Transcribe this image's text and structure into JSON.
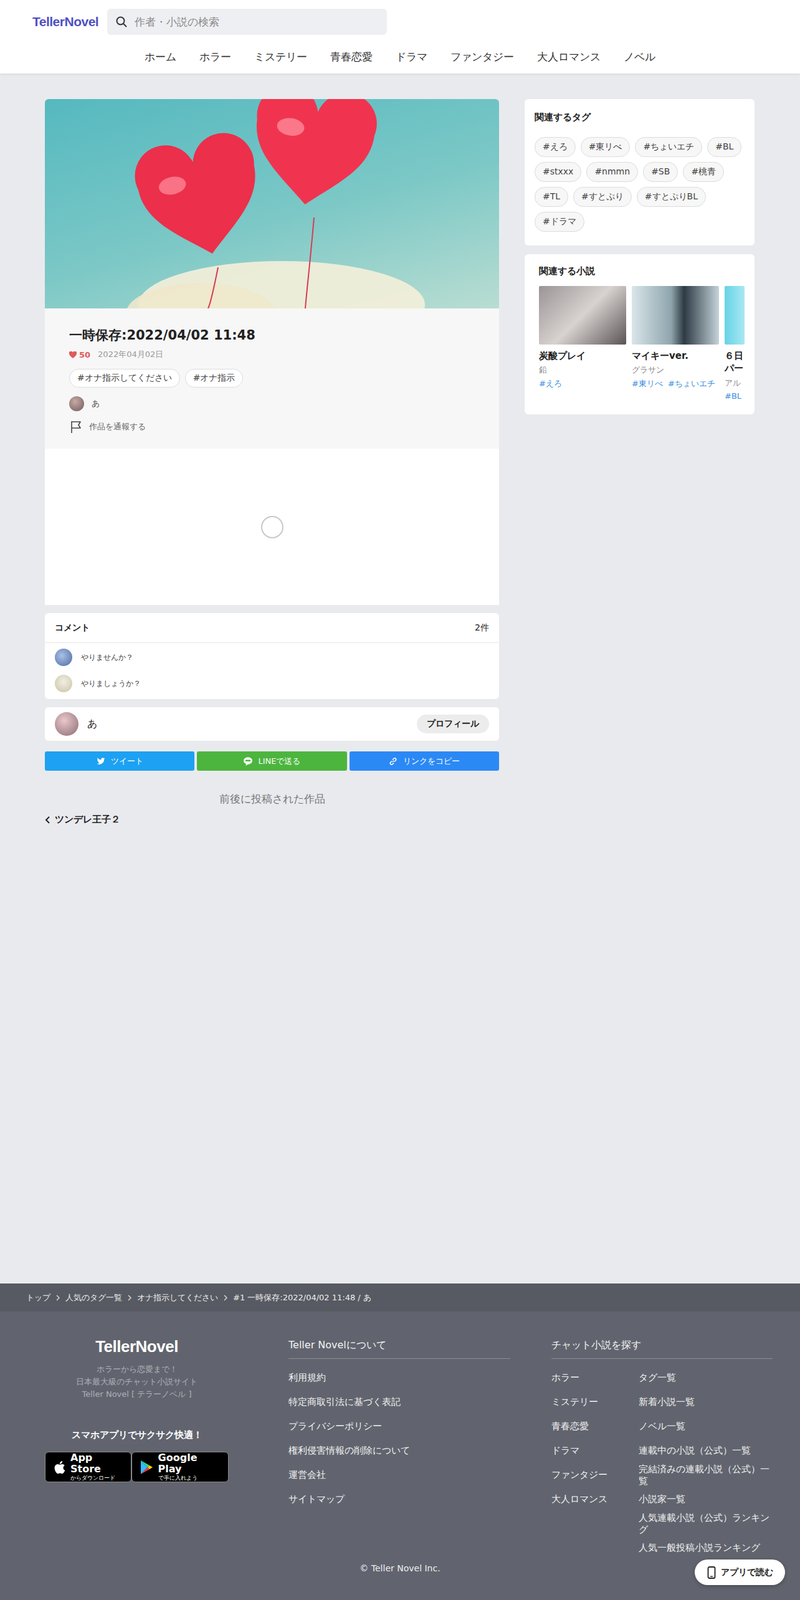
{
  "header": {
    "logo": "TellerNovel",
    "search": {
      "placeholder": "作者・小説の検索"
    },
    "nav": [
      "ホーム",
      "ホラー",
      "ミステリー",
      "青春恋愛",
      "ドラマ",
      "ファンタジー",
      "大人ロマンス",
      "ノベル"
    ]
  },
  "novel": {
    "title": "一時保存:2022/04/02 11:48",
    "likes": "50",
    "date": "2022年04月02日",
    "tags": [
      "#オナ指示してください",
      "#オナ指示"
    ],
    "author": "あ",
    "report": "作品を通報する",
    "loading": true
  },
  "comments": {
    "title": "コメント",
    "count": "2件",
    "items": [
      "やりませんか？",
      "やりましょうか？"
    ]
  },
  "profile": {
    "name": "あ",
    "button": "プロフィール"
  },
  "share": [
    {
      "label": "ツイート",
      "color": "#1da1f2",
      "kind": "twitter"
    },
    {
      "label": "LINEで送る",
      "color": "#4cb53e",
      "kind": "line"
    },
    {
      "label": "リンクをコピー",
      "color": "#2b89f5",
      "kind": "link"
    }
  ],
  "adjacent": {
    "title": "前後に投稿された作品",
    "prev": "ツンデレ王子２"
  },
  "sidebar": {
    "tags_title": "関連するタグ",
    "tags": [
      "#えろ",
      "#東リべ",
      "#ちょいエチ",
      "#BL",
      "#stxxx",
      "#nmmn",
      "#SB",
      "#桃青",
      "#TL",
      "#すとぷり",
      "#すとぷりBL",
      "#ドラマ"
    ],
    "novels_title": "関連する小説",
    "novels": [
      {
        "title": "炭酸プレイ",
        "author": "鉛",
        "tags": [
          "#えろ"
        ]
      },
      {
        "title": "マイキーver.",
        "author": "グラサン",
        "tags": [
          "#東リべ",
          "#ちょいエチ"
        ]
      },
      {
        "title": "６日パー",
        "author": "アル",
        "tags": [
          "#BL"
        ]
      }
    ]
  },
  "footer": {
    "breadcrumb": [
      "トップ",
      "人気のタグ一覧",
      "オナ指示してください",
      "#1 一時保存:2022/04/02 11:48 / あ"
    ],
    "logo": "TellerNovel",
    "tagline": [
      "ホラーから恋愛まで！",
      "日本最大級のチャット小説サイト",
      "Teller Novel [ テラーノベル ]"
    ],
    "app_prompt": "スマホアプリでサクサク快適！",
    "badges": [
      {
        "kind": "apple",
        "main": "App Store",
        "sub": "からダウンロード"
      },
      {
        "kind": "google",
        "main": "Google Play",
        "sub": "で手に入れよう"
      }
    ],
    "about": {
      "title": "Teller Novelについて",
      "links": [
        "利用規約",
        "特定商取引法に基づく表記",
        "プライバシーポリシー",
        "権利侵害情報の削除について",
        "運営会社",
        "サイトマップ"
      ]
    },
    "explore": {
      "title": "チャット小説を探す",
      "genres": [
        "ホラー",
        "ミステリー",
        "青春恋愛",
        "ドラマ",
        "ファンタジー",
        "大人ロマンス"
      ],
      "links": [
        "タグ一覧",
        "新着小説一覧",
        "ノベル一覧",
        "連載中の小説（公式）一覧",
        "完結済みの連載小説（公式）一覧",
        "小説家一覧",
        "人気連載小説（公式）ランキング",
        "人気一般投稿小説ランキング"
      ]
    },
    "copyright": "© Teller Novel Inc.",
    "app_button": "アプリで読む"
  }
}
